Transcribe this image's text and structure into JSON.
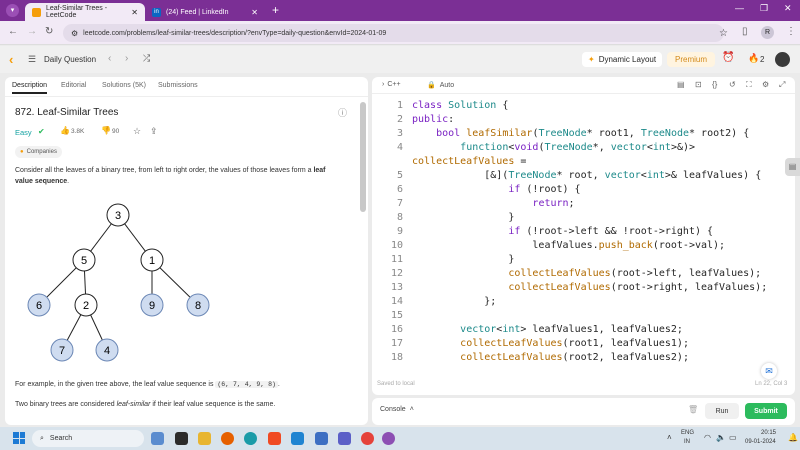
{
  "browser": {
    "tabs": [
      {
        "title": "Leaf-Similar Trees - LeetCode",
        "active": true,
        "favicon_color": "#f59e0b"
      },
      {
        "title": "(24) Feed | LinkedIn",
        "active": false,
        "favicon_color": "#0a66c2"
      }
    ],
    "url": "leetcode.com/problems/leaf-similar-trees/description/?envType=daily-question&envId=2024-01-09",
    "profile_initial": "R"
  },
  "nav": {
    "title": "Daily Question",
    "dynamic_layout": "Dynamic Layout",
    "premium": "Premium",
    "streak": "2"
  },
  "problem": {
    "tabs": [
      "Description",
      "Editorial",
      "Solutions (5K)",
      "Submissions"
    ],
    "title": "872. Leaf-Similar Trees",
    "difficulty": "Easy",
    "likes": "3.8K",
    "dislikes": "90",
    "companies": "Companies",
    "desc_pre": "Consider all the leaves of a binary tree, from left to right order, the values of those leaves form a ",
    "desc_bold1": "leaf",
    "desc_bold2": "value sequence",
    "desc_post": ".",
    "example_pre": "For example, in the given tree above, the leaf value sequence is ",
    "example_seq": "(6, 7, 4, 9, 8)",
    "example_post": ".",
    "similar_pre": "Two binary trees are considered ",
    "similar_italic": "leaf-similar",
    "similar_post": " if their leaf value sequence is the same.",
    "tree_nodes": [
      "3",
      "5",
      "1",
      "6",
      "2",
      "9",
      "8",
      "7",
      "4"
    ]
  },
  "editor": {
    "language": "C++",
    "mode": "Auto",
    "lines": [
      {
        "n": "1",
        "text": "class Solution {"
      },
      {
        "n": "2",
        "text": "public:"
      },
      {
        "n": "3",
        "text": "    bool leafSimilar(TreeNode* root1, TreeNode* root2) {"
      },
      {
        "n": "4",
        "text": "        function<void(TreeNode*, vector<int>&)>"
      },
      {
        "n": "",
        "text": "collectLeafValues ="
      },
      {
        "n": "5",
        "text": "            [&](TreeNode* root, vector<int>& leafValues) {"
      },
      {
        "n": "6",
        "text": "                if (!root) {"
      },
      {
        "n": "7",
        "text": "                    return;"
      },
      {
        "n": "8",
        "text": "                }"
      },
      {
        "n": "9",
        "text": "                if (!root->left && !root->right) {"
      },
      {
        "n": "10",
        "text": "                    leafValues.push_back(root->val);"
      },
      {
        "n": "11",
        "text": "                }"
      },
      {
        "n": "12",
        "text": "                collectLeafValues(root->left, leafValues);"
      },
      {
        "n": "13",
        "text": "                collectLeafValues(root->right, leafValues);"
      },
      {
        "n": "14",
        "text": "            };"
      },
      {
        "n": "15",
        "text": ""
      },
      {
        "n": "16",
        "text": "        vector<int> leafValues1, leafValues2;"
      },
      {
        "n": "17",
        "text": "        collectLeafValues(root1, leafValues1);"
      },
      {
        "n": "18",
        "text": "        collectLeafValues(root2, leafValues2);"
      }
    ],
    "saved": "Saved to local",
    "cursor": "Ln 22, Col 3"
  },
  "console": {
    "label": "Console",
    "run": "Run",
    "submit": "Submit"
  },
  "taskbar": {
    "search": "Search",
    "lang_top": "ENG",
    "lang_bottom": "IN",
    "time": "20:15",
    "date": "09-01-2024"
  }
}
